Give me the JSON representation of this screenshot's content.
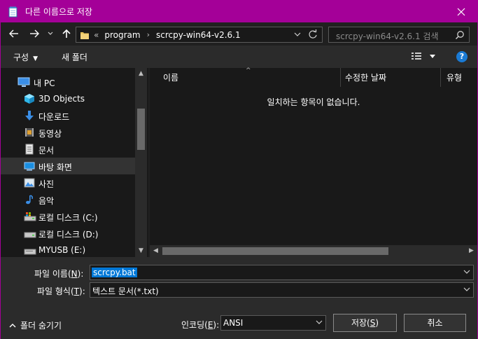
{
  "window": {
    "title": "다른 이름으로 저장"
  },
  "address": {
    "overflow": "«",
    "crumbs": [
      "program",
      "scrcpy-win64-v2.6.1"
    ]
  },
  "search": {
    "placeholder": "scrcpy-win64-v2.6.1 검색"
  },
  "toolbar": {
    "organize": "구성",
    "new_folder": "새 폴더"
  },
  "sidebar": {
    "items": [
      {
        "label": "내 PC",
        "icon": "pc-icon"
      },
      {
        "label": "3D Objects",
        "icon": "3d-objects-icon"
      },
      {
        "label": "다운로드",
        "icon": "download-icon"
      },
      {
        "label": "동영상",
        "icon": "video-icon"
      },
      {
        "label": "문서",
        "icon": "document-icon"
      },
      {
        "label": "바탕 화면",
        "icon": "desktop-icon"
      },
      {
        "label": "사진",
        "icon": "pictures-icon"
      },
      {
        "label": "음악",
        "icon": "music-icon"
      },
      {
        "label": "로컬 디스크 (C:)",
        "icon": "drive-c-icon"
      },
      {
        "label": "로컬 디스크 (D:)",
        "icon": "drive-icon"
      },
      {
        "label": "MYUSB (E:)",
        "icon": "usb-drive-icon"
      }
    ],
    "selected_index": 5
  },
  "filelist": {
    "columns": [
      "이름",
      "수정한 날짜",
      "유형"
    ],
    "empty_message": "일치하는 항목이 없습니다."
  },
  "form": {
    "filename_label": "파일 이름",
    "filename_key": "N",
    "filename_value": "scrcpy.bat",
    "filetype_label": "파일 형식",
    "filetype_key": "T",
    "filetype_value": "텍스트 문서(*.txt)",
    "encoding_label": "인코딩",
    "encoding_key": "E",
    "encoding_value": "ANSI",
    "save_label": "저장",
    "save_key": "S",
    "cancel_label": "취소",
    "hide_folders_label": "폴더 숨기기"
  },
  "colors": {
    "accent": "#a40098",
    "selection": "#0078d7",
    "help": "#1a7ad4"
  }
}
